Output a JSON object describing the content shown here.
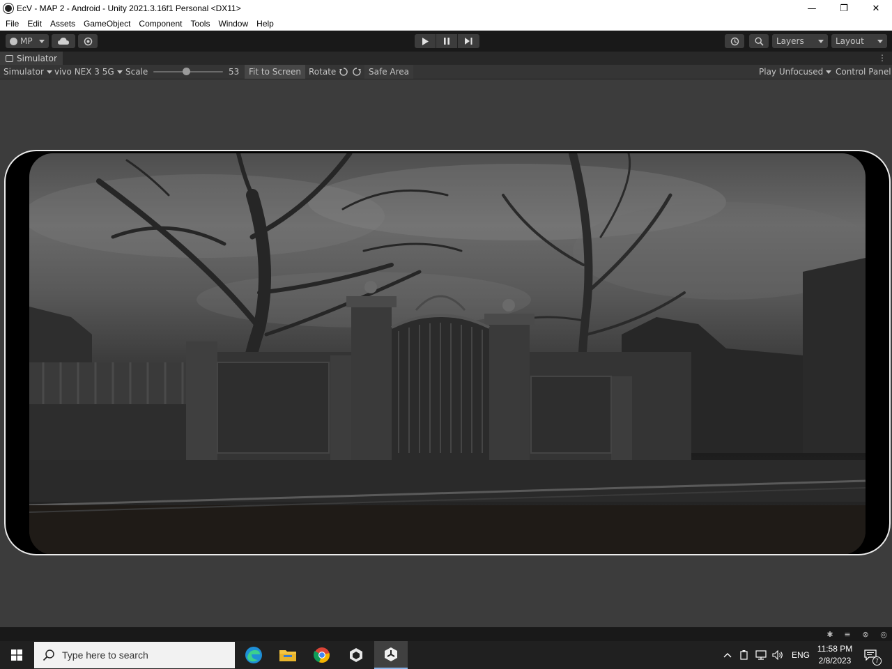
{
  "window": {
    "title": "EcV - MAP 2 - Android - Unity 2021.3.16f1 Personal <DX11>",
    "minimize": "—",
    "restore": "❐",
    "close": "✕"
  },
  "menu": [
    "File",
    "Edit",
    "Assets",
    "GameObject",
    "Component",
    "Tools",
    "Window",
    "Help"
  ],
  "toolbar": {
    "account_label": "MP",
    "layers_label": "Layers",
    "layout_label": "Layout",
    "play_icon": "play-icon",
    "pause_icon": "pause-icon",
    "step_icon": "step-icon"
  },
  "simulator_tab": {
    "label": "Simulator"
  },
  "simulator_toolbar": {
    "mode": "Simulator",
    "device": "vivo NEX 3 5G",
    "scale_label": "Scale",
    "scale_value": "53",
    "fit_to_screen": "Fit to Screen",
    "rotate_label": "Rotate",
    "safe_area": "Safe Area",
    "play_mode": "Play Unfocused",
    "control_panel": "Control Panel"
  },
  "taskbar": {
    "search_placeholder": "Type here to search",
    "language": "ENG",
    "time": "11:58 PM",
    "date": "2/8/2023",
    "notification_count": "7"
  },
  "colors": {
    "editor_bg": "#3c3c3c",
    "toolbar_bg": "#191919",
    "taskbar_bg": "#202020",
    "device_frame": "#ececec"
  }
}
